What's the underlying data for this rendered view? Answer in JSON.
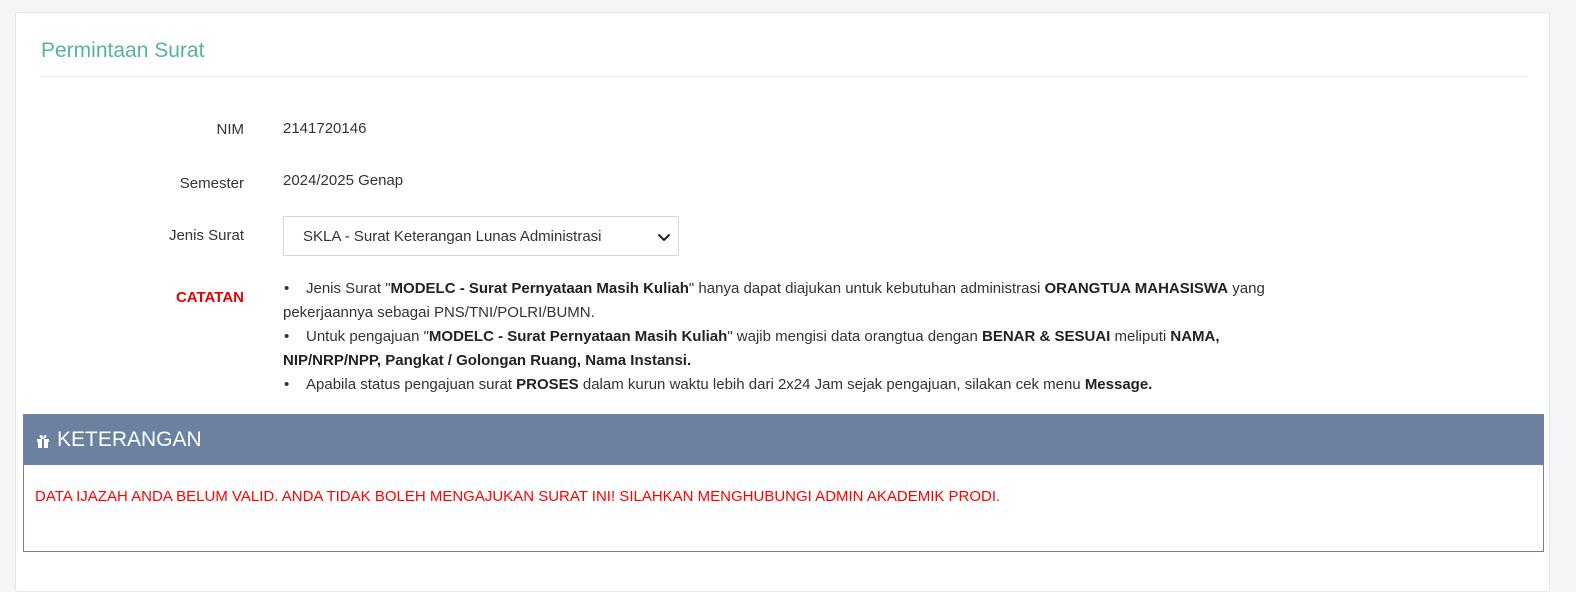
{
  "page": {
    "title": "Permintaan Surat"
  },
  "form": {
    "nim": {
      "label": "NIM",
      "value": "2141720146"
    },
    "semester": {
      "label": "Semester",
      "value": "2024/2025 Genap"
    },
    "jenis_surat": {
      "label": "Jenis Surat",
      "selected": "SKLA - Surat Keterangan Lunas Administrasi"
    }
  },
  "catatan": {
    "label": "CATATAN",
    "notes": [
      {
        "bullet": "•",
        "t1": "Jenis Surat \"",
        "b1": "MODELC - Surat Pernyataan Masih Kuliah",
        "t2": "\" hanya dapat diajukan untuk kebutuhan administrasi ",
        "b2": "ORANGTUA MAHASISWA",
        "t3": " yang pekerjaannya sebagai PNS/TNI/POLRI/BUMN."
      },
      {
        "bullet": "•",
        "t1": "Untuk pengajuan \"",
        "b1": "MODELC - Surat Pernyataan Masih Kuliah",
        "t2": "\" wajib mengisi data orangtua dengan ",
        "b2": "BENAR & SESUAI",
        "t3": " meliputi ",
        "b3": "NAMA, NIP/NRP/NPP, Pangkat / Golongan Ruang, Nama Instansi."
      },
      {
        "bullet": "•",
        "t1": "Apabila status pengajuan surat ",
        "b1": "PROSES",
        "t2": " dalam kurun waktu lebih dari 2x24 Jam sejak pengajuan, silakan cek menu ",
        "b2": "Message."
      }
    ]
  },
  "keterangan": {
    "title": "KETERANGAN",
    "icon": "gift-icon",
    "message": "DATA IJAZAH ANDA BELUM VALID. ANDA TIDAK BOLEH MENGAJUKAN SURAT INI! SILAHKAN MENGHUBUNGI ADMIN AKADEMIK PRODI."
  },
  "colors": {
    "title": "#55b59c",
    "catatan": "#e60000",
    "panel_header": "#6a81a0",
    "error": "#ff0000"
  }
}
